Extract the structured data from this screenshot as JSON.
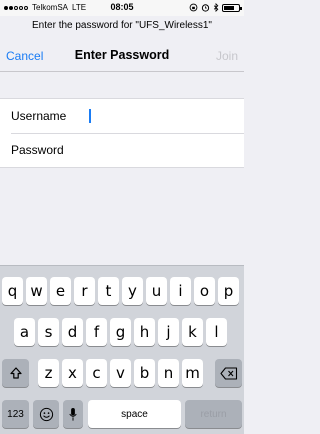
{
  "status": {
    "carrier": "TelkomSA",
    "network": "LTE",
    "time": "08:05"
  },
  "prompt": "Enter the password for \"UFS_Wireless1\"",
  "nav": {
    "cancel": "Cancel",
    "title": "Enter Password",
    "join": "Join"
  },
  "form": {
    "username_label": "Username",
    "password_label": "Password",
    "username_value": "",
    "password_value": ""
  },
  "keyboard": {
    "row1": [
      "q",
      "w",
      "e",
      "r",
      "t",
      "y",
      "u",
      "i",
      "o",
      "p"
    ],
    "row2": [
      "a",
      "s",
      "d",
      "f",
      "g",
      "h",
      "j",
      "k",
      "l"
    ],
    "row3": [
      "z",
      "x",
      "c",
      "v",
      "b",
      "n",
      "m"
    ],
    "numbers": "123",
    "space": "space",
    "return": "return",
    "shift_icon": "shift-icon",
    "delete_icon": "backspace-icon",
    "emoji_icon": "emoji-icon",
    "mic_icon": "microphone-icon"
  },
  "colors": {
    "accent": "#1a7cf4",
    "disabled": "#c7c7cc"
  }
}
